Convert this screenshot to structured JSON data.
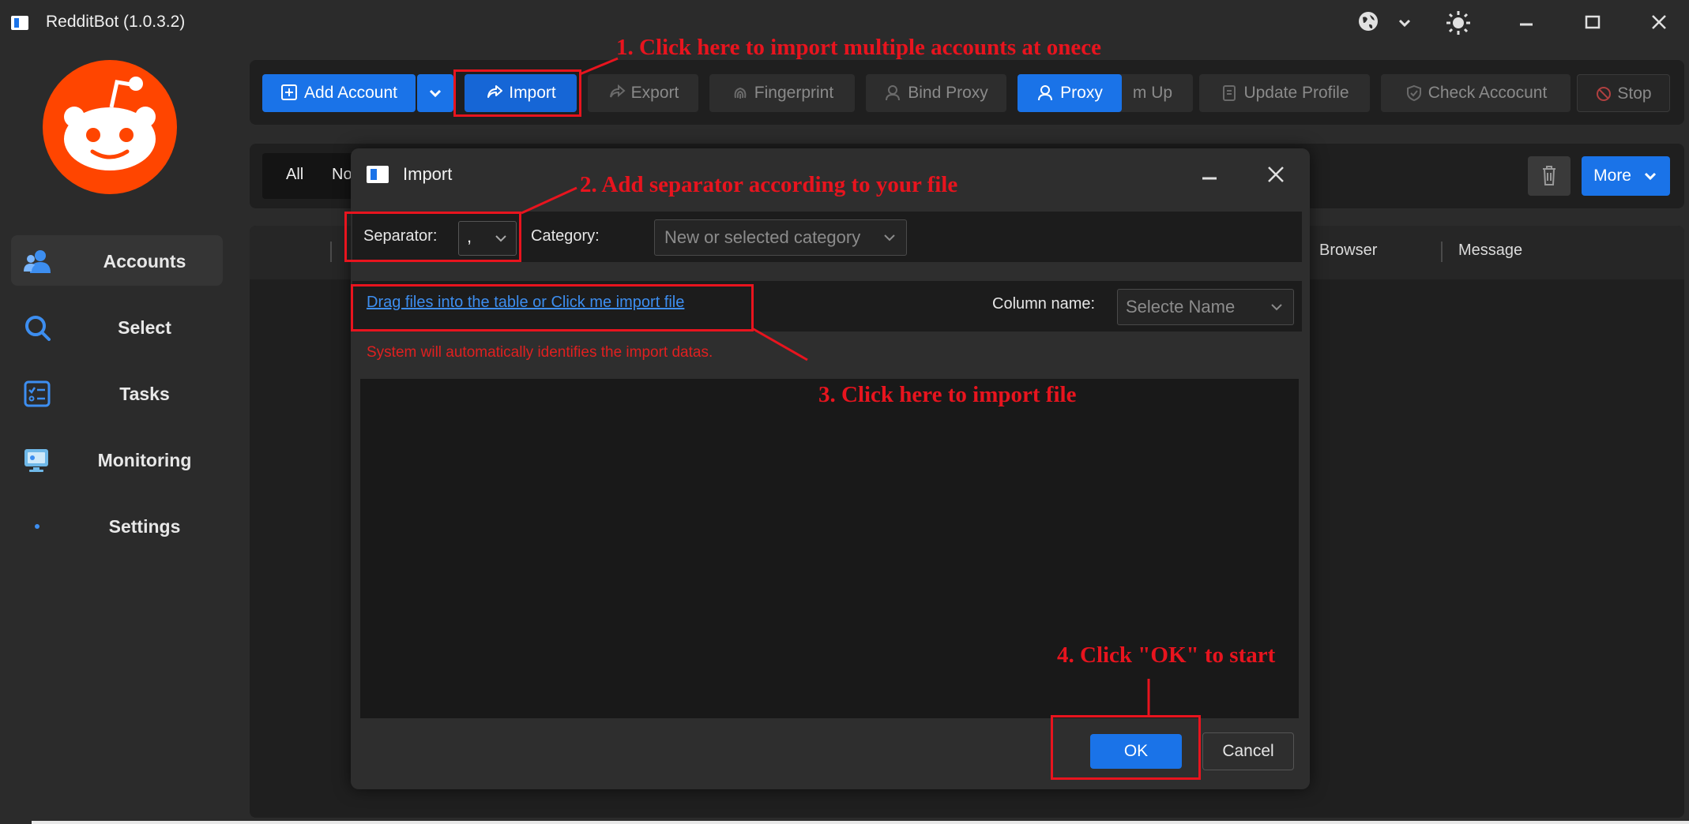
{
  "app": {
    "title": "RedditBot (1.0.3.2)"
  },
  "window_icons": [
    "globe-icon",
    "chevron-down-icon",
    "sun-icon",
    "minimize-icon",
    "maximize-icon",
    "close-icon"
  ],
  "sidebar": {
    "items": [
      {
        "label": "Accounts",
        "icon": "accounts-icon",
        "active": true
      },
      {
        "label": "Select",
        "icon": "search-icon"
      },
      {
        "label": "Tasks",
        "icon": "tasks-icon"
      },
      {
        "label": "Monitoring",
        "icon": "monitoring-icon"
      },
      {
        "label": "Settings",
        "icon": "settings-icon"
      }
    ]
  },
  "toolbar": {
    "add_account": "Add Account",
    "import": "Import",
    "export": "Export",
    "fingerprint": "Fingerprint",
    "bind_proxy": "Bind Proxy",
    "proxy": "Proxy",
    "warm_up_partial": "m Up",
    "update_profile": "Update Profile",
    "check_account": "Check Accocunt",
    "stop": "Stop"
  },
  "filters": {
    "all": "All",
    "partial": "No",
    "more": "More"
  },
  "table": {
    "columns": [
      "Browser",
      "Message"
    ]
  },
  "dialog": {
    "title": "Import",
    "separator_label": "Separator:",
    "separator_value": ",",
    "category_label": "Category:",
    "category_placeholder": "New or selected category",
    "import_link": "Drag files into the table or Click me import file",
    "column_name_label": "Column name:",
    "column_name_placeholder": "Selecte Name",
    "info": "System will automatically identifies the import datas.",
    "ok": "OK",
    "cancel": "Cancel"
  },
  "annotations": {
    "step1": "1. Click here to import multiple accounts at onece",
    "step2": "2. Add separator according to your file",
    "step3": "3. Click here to import file",
    "step4": "4. Click \"OK\" to start"
  },
  "colors": {
    "accent": "#1a73e8",
    "annotation": "#e8141e",
    "reddit_orange": "#ff4500",
    "info_text": "#e02020"
  }
}
